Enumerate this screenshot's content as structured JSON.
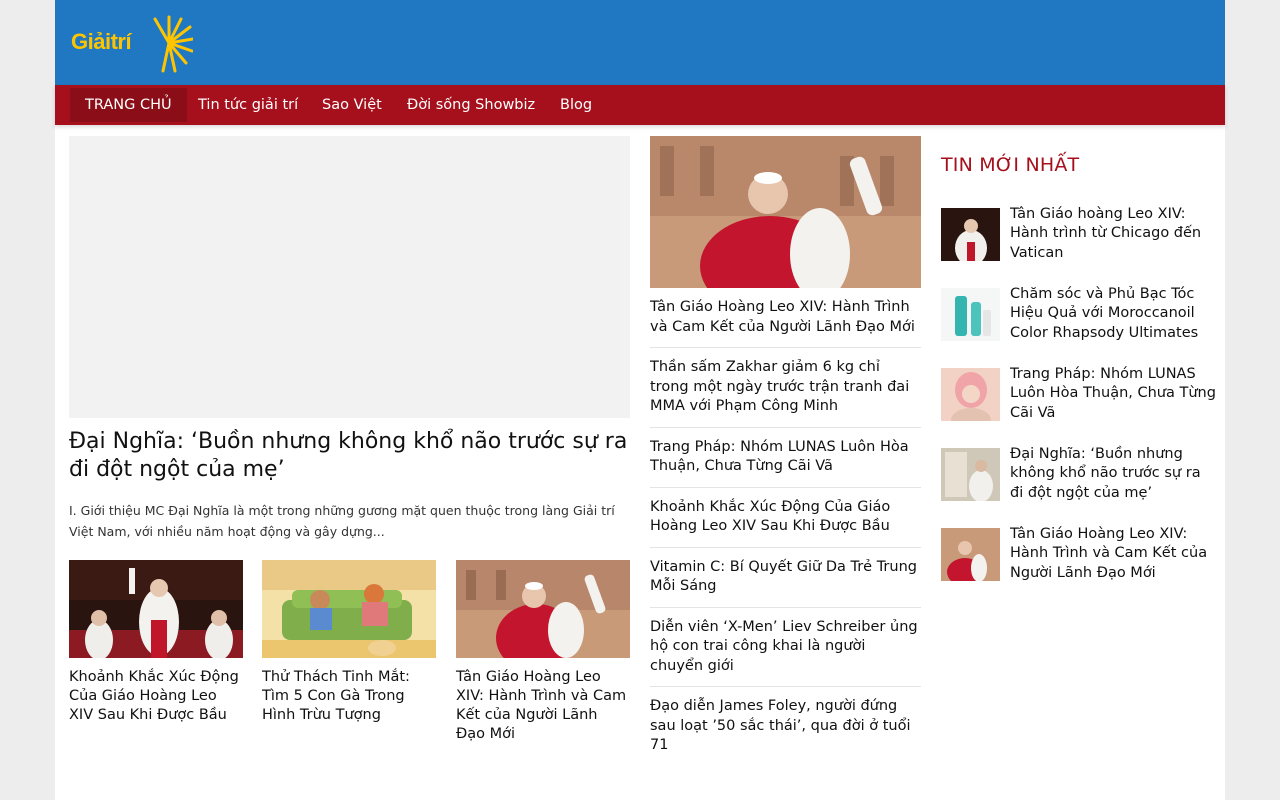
{
  "logo": {
    "text": "Giảitrí"
  },
  "nav": {
    "items": [
      "TRANG CHỦ",
      "Tin tức giải trí",
      "Sao Việt",
      "Đời sống Showbiz",
      "Blog"
    ]
  },
  "featured": {
    "title": "Đại Nghĩa: ‘Buồn nhưng không khổ não trước sự ra đi đột ngột của mẹ’",
    "excerpt": "I. Giới thiệu MC Đại Nghĩa là một trong những gương mặt quen thuộc trong làng Giải trí Việt Nam, với nhiều năm hoạt động và gây dựng..."
  },
  "cards": [
    {
      "title": "Khoảnh Khắc Xúc Động Của Giáo Hoàng Leo XIV Sau Khi Được Bầu"
    },
    {
      "title": "Thử Thách Tinh Mắt: Tìm 5 Con Gà Trong Hình Trừu Tượng"
    },
    {
      "title": "Tân Giáo Hoàng Leo XIV: Hành Trình và Cam Kết của Người Lãnh Đạo Mới"
    }
  ],
  "middle": {
    "items": [
      "Tân Giáo Hoàng Leo XIV: Hành Trình và Cam Kết của Người Lãnh Đạo Mới",
      "Thần sấm Zakhar giảm 6 kg chỉ trong một ngày trước trận tranh đai MMA với Phạm Công Minh",
      "Trang Pháp: Nhóm LUNAS Luôn Hòa Thuận, Chưa Từng Cãi Vã",
      "Khoảnh Khắc Xúc Động Của Giáo Hoàng Leo XIV Sau Khi Được Bầu",
      "Vitamin C: Bí Quyết Giữ Da Trẻ Trung Mỗi Sáng",
      "Diễn viên ‘X-Men’ Liev Schreiber ủng hộ con trai công khai là người chuyển giới",
      "Đạo diễn James Foley, người đứng sau loạt ’50 sắc thái’, qua đời ở tuổi 71"
    ]
  },
  "sidebar": {
    "heading": "TIN MỚI NHẤT",
    "items": [
      "Tân Giáo hoàng Leo XIV: Hành trình từ Chicago đến Vatican",
      "Chăm sóc và Phủ Bạc Tóc Hiệu Quả với Moroccanoil Color Rhapsody Ultimates",
      "Trang Pháp: Nhóm LUNAS Luôn Hòa Thuận, Chưa Từng Cãi Vã",
      "Đại Nghĩa: ‘Buồn nhưng không khổ não trước sự ra đi đột ngột của mẹ’",
      "Tân Giáo Hoàng Leo XIV: Hành Trình và Cam Kết của Người Lãnh Đạo Mới"
    ]
  },
  "colors": {
    "header": "#1f78c1",
    "nav": "#a5101c",
    "accent": "#a5101c",
    "logo": "#ffc400"
  }
}
